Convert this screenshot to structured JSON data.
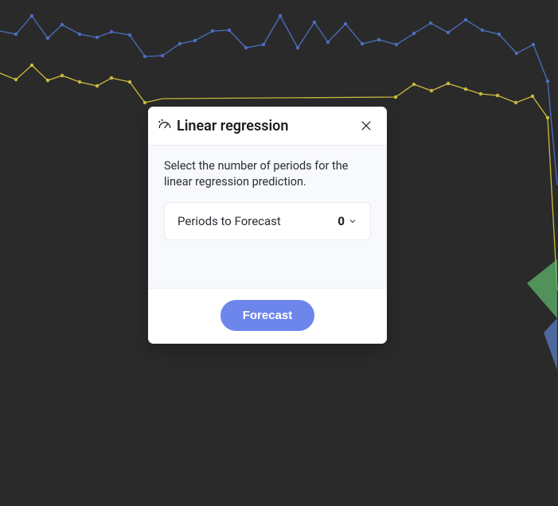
{
  "modal": {
    "title": "Linear regression",
    "description": "Select the number of periods for the linear regression prediction.",
    "field": {
      "label": "Periods to Forecast",
      "value": "0"
    },
    "submit_label": "Forecast"
  },
  "bg_chart": {
    "series1_color": "#4c6fc0",
    "series2_color": "#c9bb3e"
  }
}
